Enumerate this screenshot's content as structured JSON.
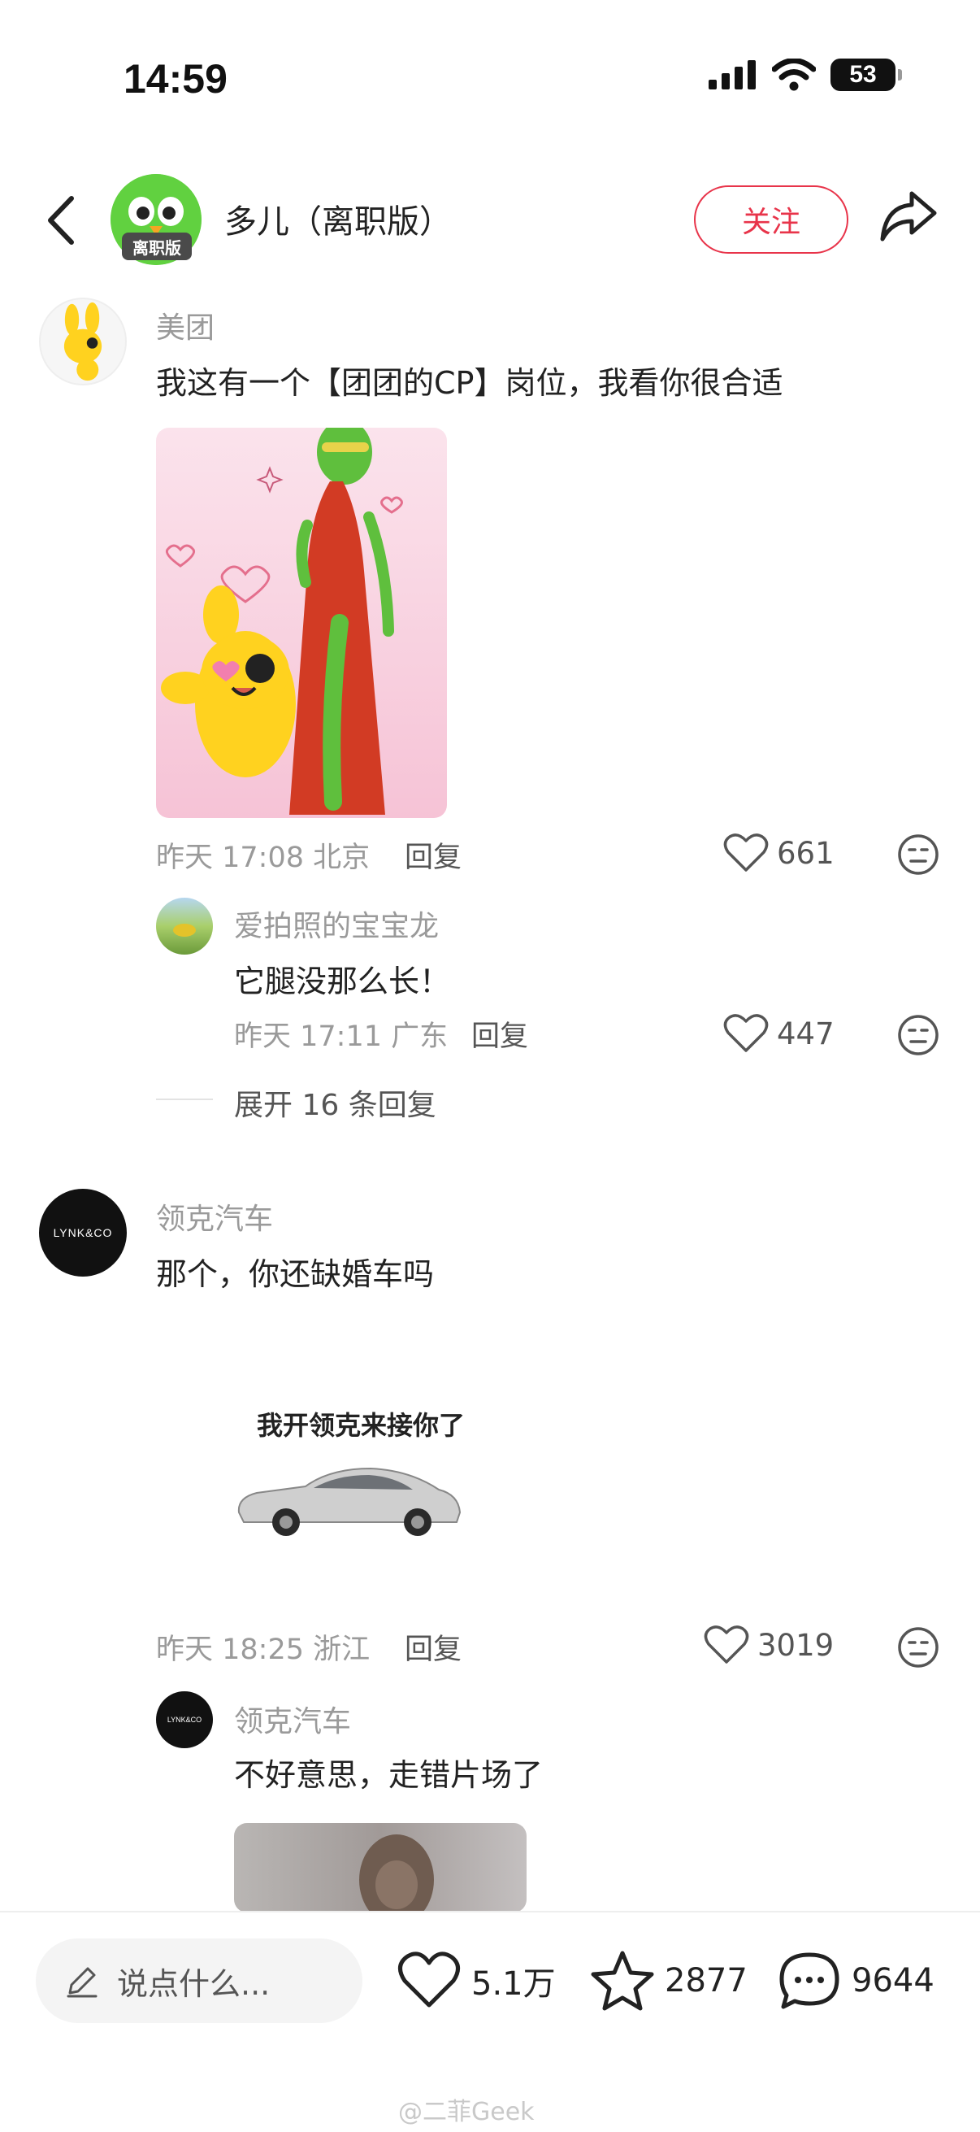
{
  "status_bar": {
    "time": "14:59",
    "battery": "53"
  },
  "header": {
    "title": "多儿（离职版）",
    "badge": "离职版",
    "follow_label": "关注",
    "accent_color": "#e8344a"
  },
  "comments": [
    {
      "user": "美团",
      "text": "我这有一个【团团的CP】岗位，我看你很合适",
      "time": "昨天 17:08 北京",
      "reply_label": "回复",
      "likes": "661",
      "replies": [
        {
          "user": "爱拍照的宝宝龙",
          "text": "它腿没那么长！",
          "time": "昨天 17:11 广东",
          "reply_label": "回复",
          "likes": "447"
        }
      ],
      "expand_label": "展开 16 条回复"
    },
    {
      "user": "领克汽车",
      "avatar_text": "LYNK&CO",
      "text": "那个，你还缺婚车吗",
      "image_caption": "我开领克来接你了",
      "time": "昨天 18:25 浙江",
      "reply_label": "回复",
      "likes": "3019",
      "replies": [
        {
          "user": "领克汽车",
          "avatar_text": "LYNK&CO",
          "text": "不好意思，走错片场了"
        }
      ]
    }
  ],
  "bottom_bar": {
    "placeholder": "说点什么...",
    "likes": "5.1万",
    "favorites": "2877",
    "comments": "9644"
  },
  "watermark": "@二菲Geek",
  "icons": [
    "back-icon",
    "share-icon",
    "heart-icon",
    "emoji-icon",
    "pencil-icon",
    "star-icon",
    "comment-icon",
    "signal-icon",
    "wifi-icon",
    "battery-icon"
  ]
}
